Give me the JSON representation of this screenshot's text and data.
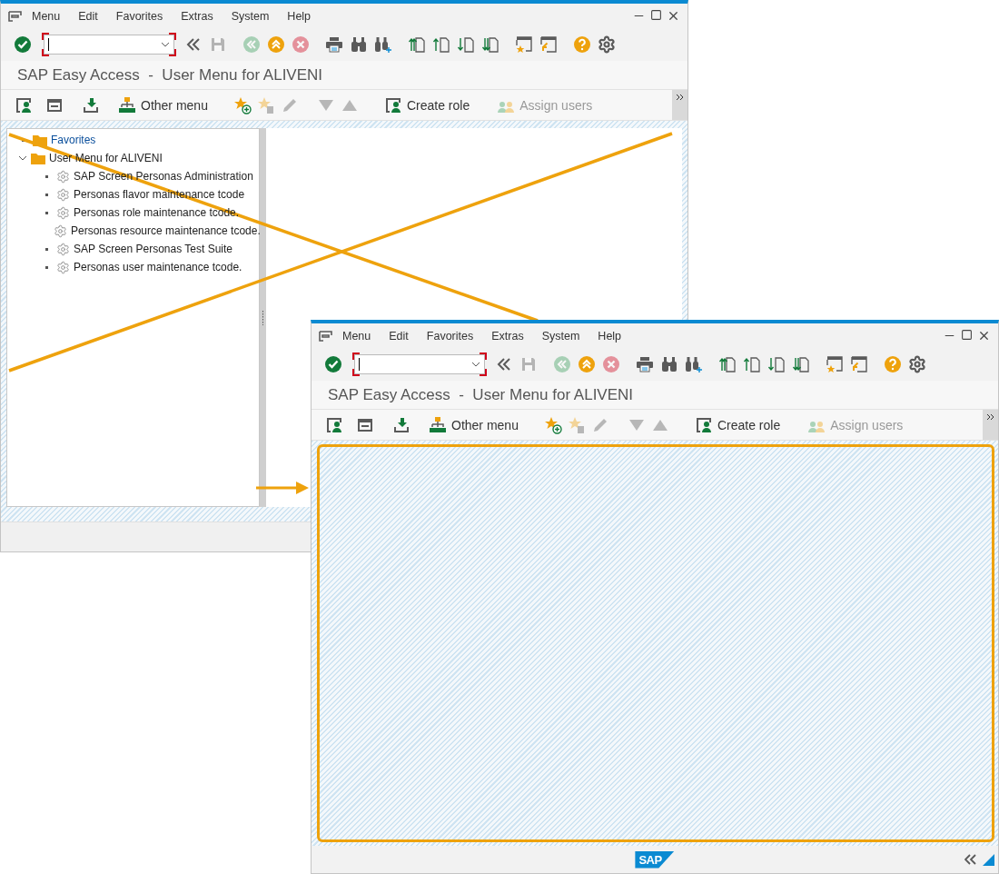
{
  "windows": [
    {
      "menu": [
        "Menu",
        "Edit",
        "Favorites",
        "Extras",
        "System",
        "Help"
      ],
      "toolbar": [
        {
          "kind": "enter",
          "disabled": false
        },
        {
          "kind": "command-field",
          "disabled": false
        },
        {
          "kind": "history",
          "disabled": false
        },
        {
          "kind": "save",
          "disabled": true
        },
        {
          "kind": "back",
          "disabled": true
        },
        {
          "kind": "exit",
          "disabled": false
        },
        {
          "kind": "cancel",
          "disabled": true
        },
        {
          "kind": "print",
          "disabled": false
        },
        {
          "kind": "find",
          "disabled": false
        },
        {
          "kind": "find-next",
          "disabled": false
        },
        {
          "kind": "first-page",
          "disabled": false
        },
        {
          "kind": "prev-page",
          "disabled": false
        },
        {
          "kind": "next-page",
          "disabled": false
        },
        {
          "kind": "last-page",
          "disabled": false
        },
        {
          "kind": "new-session",
          "disabled": false
        },
        {
          "kind": "shortcut",
          "disabled": false
        },
        {
          "kind": "help",
          "disabled": false
        },
        {
          "kind": "customize",
          "disabled": false
        }
      ],
      "title": "SAP Easy Access  -  User Menu for ALIVENI",
      "app_toolbar": [
        {
          "kind": "user-menu",
          "disabled": false
        },
        {
          "kind": "sap-menu",
          "disabled": false
        },
        {
          "kind": "download",
          "disabled": false
        },
        {
          "kind": "other-menu",
          "label": "Other menu",
          "disabled": false
        },
        {
          "kind": "add-favorite",
          "disabled": false
        },
        {
          "kind": "delete-favorite",
          "disabled": true
        },
        {
          "kind": "edit",
          "disabled": true
        },
        {
          "kind": "move-down",
          "disabled": true
        },
        {
          "kind": "move-up",
          "disabled": true
        },
        {
          "kind": "create-role",
          "label": "Create role",
          "disabled": false
        },
        {
          "kind": "assign-users",
          "label": "Assign users",
          "disabled": true
        }
      ],
      "tree": [
        {
          "label": "Favorites",
          "kind": "folder",
          "selected": true
        },
        {
          "label": "User Menu for ALIVENI",
          "kind": "folder",
          "selected": false,
          "expanded": true,
          "children": [
            {
              "label": "SAP Screen Personas Administration",
              "kind": "transaction",
              "selected": false
            },
            {
              "label": "Personas flavor maintenance tcode",
              "kind": "transaction",
              "selected": false
            },
            {
              "label": "Personas role maintenance tcode.",
              "kind": "transaction",
              "selected": false
            },
            {
              "label": "Personas resource maintenance tcode.",
              "kind": "transaction",
              "selected": false
            },
            {
              "label": "SAP Screen Personas Test Suite",
              "kind": "transaction",
              "selected": false
            },
            {
              "label": "Personas user maintenance tcode.",
              "kind": "transaction",
              "selected": false
            }
          ]
        }
      ]
    },
    {
      "menu": [
        "Menu",
        "Edit",
        "Favorites",
        "Extras",
        "System",
        "Help"
      ],
      "toolbar": [
        {
          "kind": "enter",
          "disabled": false
        },
        {
          "kind": "command-field",
          "disabled": false
        },
        {
          "kind": "history",
          "disabled": false
        },
        {
          "kind": "save",
          "disabled": true
        },
        {
          "kind": "back",
          "disabled": true
        },
        {
          "kind": "exit",
          "disabled": false
        },
        {
          "kind": "cancel",
          "disabled": true
        },
        {
          "kind": "print",
          "disabled": false
        },
        {
          "kind": "find",
          "disabled": false
        },
        {
          "kind": "find-next",
          "disabled": false
        },
        {
          "kind": "first-page",
          "disabled": false
        },
        {
          "kind": "prev-page",
          "disabled": false
        },
        {
          "kind": "next-page",
          "disabled": false
        },
        {
          "kind": "last-page",
          "disabled": false
        },
        {
          "kind": "new-session",
          "disabled": false
        },
        {
          "kind": "shortcut",
          "disabled": false
        },
        {
          "kind": "help",
          "disabled": false
        },
        {
          "kind": "customize",
          "disabled": false
        }
      ],
      "title": "SAP Easy Access  -  User Menu for ALIVENI",
      "app_toolbar": [
        {
          "kind": "user-menu",
          "disabled": false
        },
        {
          "kind": "sap-menu",
          "disabled": false
        },
        {
          "kind": "download",
          "disabled": false
        },
        {
          "kind": "other-menu",
          "label": "Other menu",
          "disabled": false
        },
        {
          "kind": "add-favorite",
          "disabled": false
        },
        {
          "kind": "delete-favorite",
          "disabled": true
        },
        {
          "kind": "edit",
          "disabled": true
        },
        {
          "kind": "move-down",
          "disabled": true
        },
        {
          "kind": "move-up",
          "disabled": true
        },
        {
          "kind": "create-role",
          "label": "Create role",
          "disabled": false
        },
        {
          "kind": "assign-users",
          "label": "Assign users",
          "disabled": true
        }
      ],
      "highlighted": true,
      "footer": {
        "logo": "SAP"
      }
    }
  ]
}
